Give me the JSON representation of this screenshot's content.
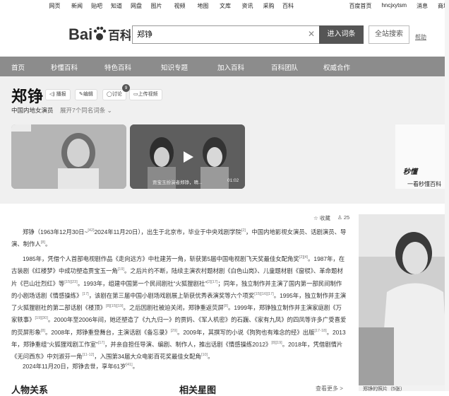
{
  "topnav": {
    "links": [
      "网页",
      "新闻",
      "贴吧",
      "知道",
      "网盘",
      "图片",
      "视频",
      "地图",
      "文库",
      "资讯",
      "采购",
      "百科"
    ],
    "right": [
      "百度首页",
      "hncjxytsm",
      "消息",
      "商城"
    ]
  },
  "logo": {
    "text": "Bai",
    "brand": "百科"
  },
  "search": {
    "value": "郑铮",
    "enter_label": "进入词条",
    "site_label": "全站搜索",
    "help_label": "帮助"
  },
  "mainnav": {
    "items": [
      "首页",
      "秒懂百科",
      "特色百科",
      "知识专题",
      "加入百科",
      "百科团队",
      "权威合作"
    ]
  },
  "entry": {
    "title": "郑铮",
    "tools": [
      "播报",
      "编辑",
      "讨论",
      "上传视频"
    ],
    "discuss_count": "9",
    "subtitle": "中国内地女演员",
    "same_words": "展开7个同名词条"
  },
  "videos": {
    "v1_caption": "",
    "v2_caption": "贾宝玉扮演者郑铮，晴...",
    "v2_time": "01:02",
    "side_text1": "秒懂",
    "side_text2": "一看秒懂百科"
  },
  "actions": {
    "collect": "收藏",
    "likes": "25"
  },
  "paragraphs": [
    "郑铮（1963年12月30日~[42]2024年11月20日），出生于北京市，毕业于中央戏剧学院[2]，中国内地影视女演员、话剧演员、导演、制作人[8]。",
    "1985年，凭借个人首部电视剧作品《走向远方》中杜建芳一角，斩获第5届中国电视剧飞天奖最佳女配角奖[2][4]。1987年，在古装剧《红楼梦》中成功塑造贾宝玉一角[19]。之后片约不断，陆续主演农村题材剧《白色山岗》、儿童题材剧《窗棂》、革命题材片《巴山壮烈红》等[15][23]。1993年，组建中国第一个民间剧社“火狐狸剧社”[2][17]；同年，独立制作并主演了国内第一部民间制作的小剧场话剧《情感操练》[17]，该剧在第三届中国小剧场戏剧展上斩获优秀表演奖等六个项奖[15][16][17]。1995年，独立制作并主演了火狐狸剧社的第二部话剧《楼顶》[8][15][19]。之后因剧社被迫关闭，郑铮重返荧屏[8]。1999年，郑铮独立制作并主演家庭剧《万家轶事》[19][30]。2000年至2006年间，她还塑造了《九九归一》的贾妈、《军人机密》的石巍、《家有九凤》的四凤等许多广受喜爱的荧屏形象[8]。2008年，郑铮重登舞台，主演话剧《备忘录》[29]。2009年，其撰写的小说《狗狗也有难念的经》出版[17-18]。2013年，郑铮重组“火狐狸戏剧工作室”[17]，并亲自担任导演、编剧、制作人，推出话剧《情感操练2012》[8][19]。2018年，凭借剧情片《无问西东》中刘淑芬一角[11-12]，入围第34届大众电影百花奖最佳女配角[10]。",
    "2024年11月20日，郑铮去世，享年61岁[41]。"
  ],
  "portrait_caption": "郑铮的照片（5张）",
  "sections": {
    "relations": "人物关系",
    "related_stars": "相关星图",
    "more": "查看更多 >"
  },
  "colors": {
    "navbar": "#8c8c8c",
    "enter_button": "#555555",
    "header_bg": "#f0f0f0"
  }
}
